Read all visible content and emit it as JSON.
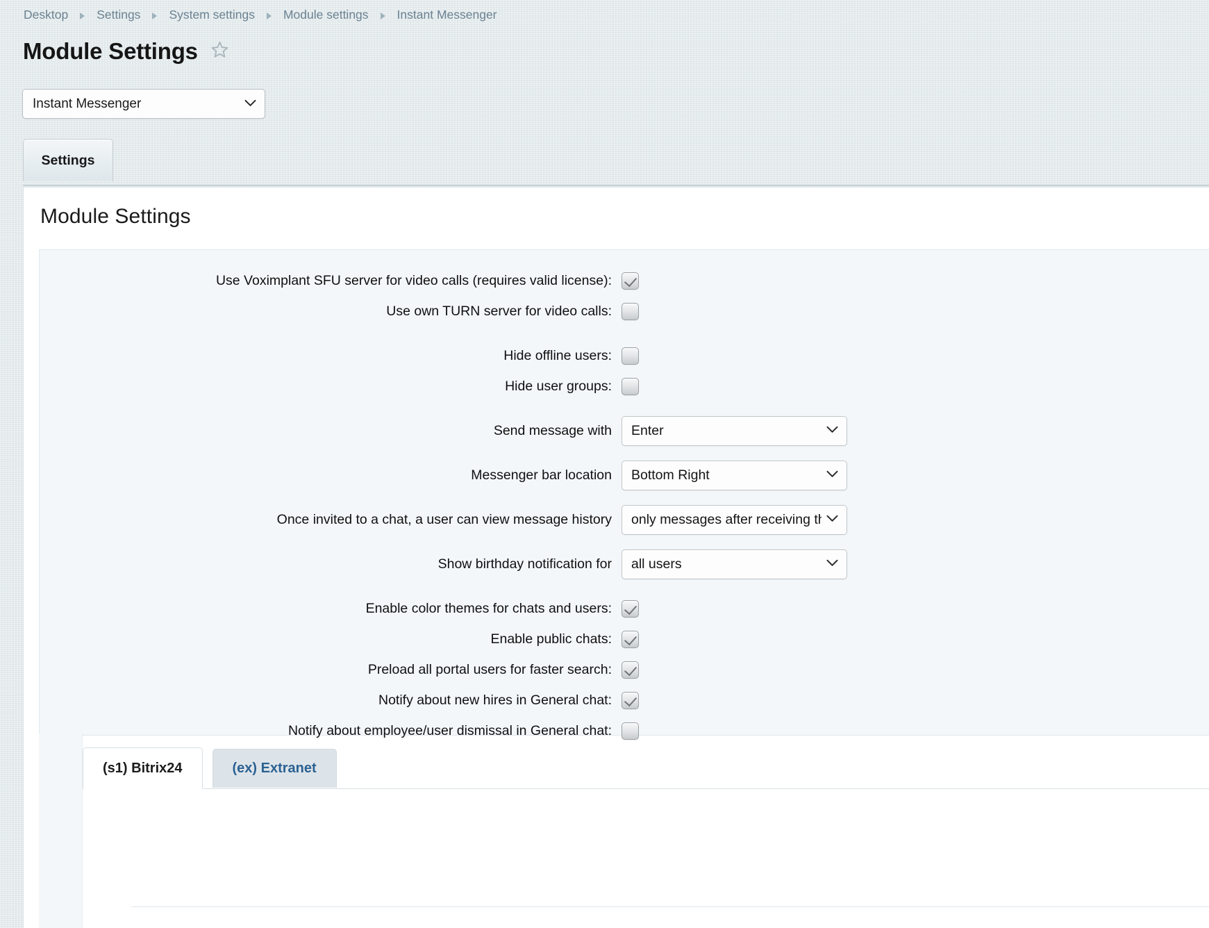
{
  "breadcrumb": {
    "items": [
      {
        "label": "Desktop"
      },
      {
        "label": "Settings"
      },
      {
        "label": "System settings"
      },
      {
        "label": "Module settings"
      },
      {
        "label": "Instant Messenger"
      }
    ],
    "separator_icon": "chevron-right-icon"
  },
  "header": {
    "title": "Module Settings",
    "favorite_icon": "star-outline-icon"
  },
  "module_selector": {
    "value": "Instant Messenger",
    "options": [
      "Instant Messenger"
    ],
    "chevron_icon": "chevron-down-icon"
  },
  "main_tabs": [
    {
      "label": "Settings",
      "active": true
    }
  ],
  "content": {
    "heading": "Module Settings"
  },
  "form": {
    "rows": [
      {
        "type": "checkbox",
        "label": "Use Voximplant SFU server for video calls (requires valid license):",
        "name": "use-voximplant-sfu-server-checkbox",
        "checked": true,
        "gap_before": false
      },
      {
        "type": "checkbox",
        "label": "Use own TURN server for video calls:",
        "name": "use-own-turn-server-checkbox",
        "checked": false,
        "gap_before": false
      },
      {
        "type": "checkbox",
        "label": "Hide offline users:",
        "name": "hide-offline-users-checkbox",
        "checked": false,
        "gap_before": true
      },
      {
        "type": "checkbox",
        "label": "Hide user groups:",
        "name": "hide-user-groups-checkbox",
        "checked": false,
        "gap_before": false
      },
      {
        "type": "select",
        "label": "Send message with",
        "name": "send-message-with-select",
        "value": "Enter",
        "options": [
          "Enter"
        ],
        "gap_before": true
      },
      {
        "type": "select",
        "label": "Messenger bar location",
        "name": "messenger-bar-location-select",
        "value": "Bottom Right",
        "options": [
          "Bottom Right"
        ],
        "gap_before": true
      },
      {
        "type": "select",
        "label": "Once invited to a chat, a user can view message history",
        "name": "message-history-visibility-select",
        "value": "only messages after receiving the invitation",
        "options": [
          "only messages after receiving the invitation"
        ],
        "gap_before": true
      },
      {
        "type": "select",
        "label": "Show birthday notification for",
        "name": "birthday-notification-audience-select",
        "value": "all users",
        "options": [
          "all users"
        ],
        "gap_before": true
      },
      {
        "type": "checkbox",
        "label": "Enable color themes for chats and users:",
        "name": "enable-color-themes-checkbox",
        "checked": true,
        "gap_before": true
      },
      {
        "type": "checkbox",
        "label": "Enable public chats:",
        "name": "enable-public-chats-checkbox",
        "checked": true,
        "gap_before": false
      },
      {
        "type": "checkbox",
        "label": "Preload all portal users for faster search:",
        "name": "preload-portal-users-checkbox",
        "checked": true,
        "gap_before": false
      },
      {
        "type": "checkbox",
        "label": "Notify about new hires in General chat:",
        "name": "notify-new-hires-checkbox",
        "checked": true,
        "gap_before": false
      },
      {
        "type": "checkbox",
        "label": "Notify about employee/user dismissal in General chat:",
        "name": "notify-dismissal-checkbox",
        "checked": false,
        "gap_before": false
      }
    ]
  },
  "site_tabs": [
    {
      "label": "(s1) Bitrix24",
      "active": true,
      "name": "site-tab-bitrix24"
    },
    {
      "label": "(ex) Extranet",
      "active": false,
      "name": "site-tab-extranet"
    }
  ],
  "colors": {
    "page_background": "#e4ebee",
    "panel_background": "#ffffff",
    "form_background": "#f3f7fa",
    "breadcrumb_link": "#6a8291",
    "inactive_tab_link": "#2b6192",
    "checkbox_border": "#9aa0a4"
  }
}
